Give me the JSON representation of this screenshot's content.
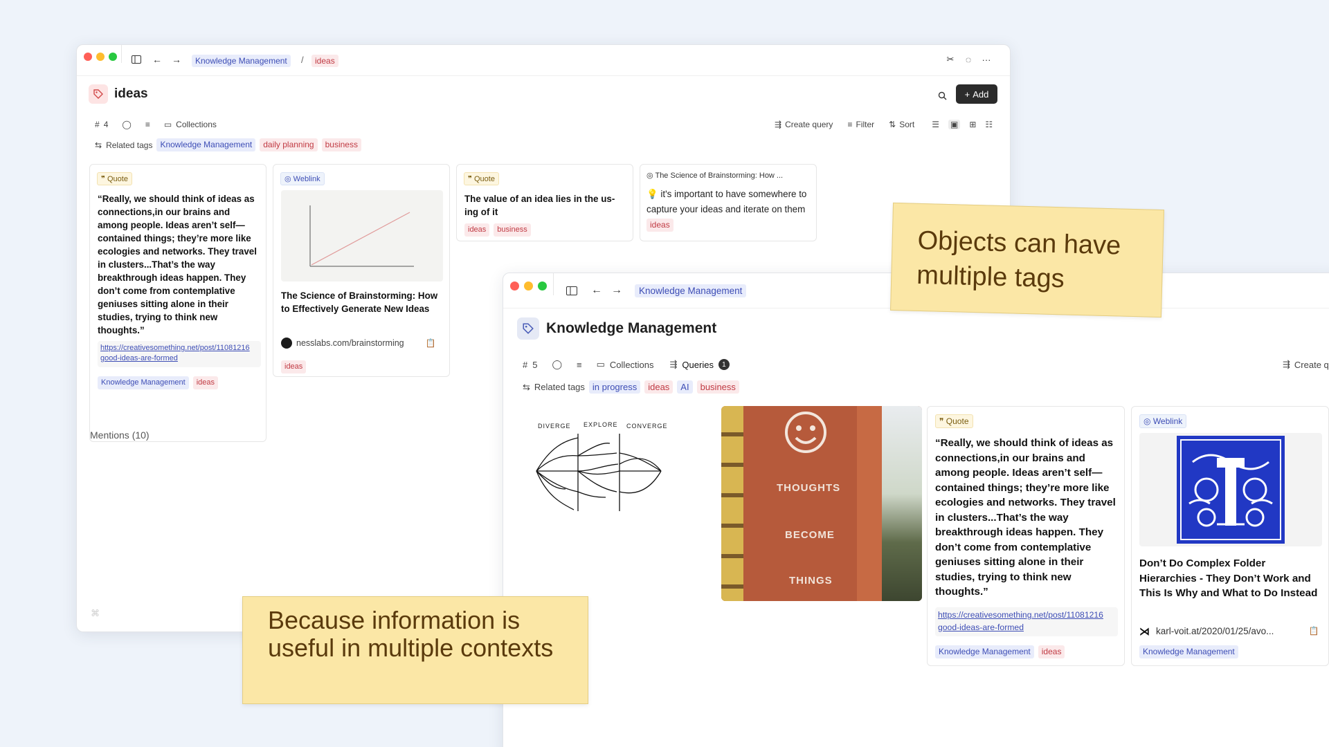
{
  "colors": {
    "accent": "#3d4db5",
    "tag_red": "#c03a43",
    "note_bg": "#fbe7a6"
  },
  "win1": {
    "breadcrumb": [
      "Knowledge Management",
      "ideas"
    ],
    "breadcrumb_sep": "/",
    "title": "ideas",
    "add_label": "Add",
    "count": "4",
    "collections_label": "Collections",
    "create_query_label": "Create query",
    "filter_label": "Filter",
    "sort_label": "Sort",
    "related_tags_label": "Related tags",
    "related_tags": [
      "Knowledge Management",
      "daily planning",
      "business"
    ],
    "cards": [
      {
        "badge": "Quote",
        "text": "“Really, we should think of ideas as connections,in our brains and among people. Ideas aren’t self—contained things; they’re more like ecologies and networks. They travel in clusters...That’s the way breakthrough ideas happen. They don’t come from contemplative geniuses sitting alone in their studies, trying to think new thoughts.”",
        "link": "https://creativesomething.net/post/11081216 good-ideas-are-formed",
        "tags": [
          "Knowledge Management",
          "ideas"
        ]
      },
      {
        "badge": "Weblink",
        "title": "The Science of Brainstorming: How to Effectively Generate New Ideas",
        "source": "nesslabs.com/brainstorming",
        "tags": [
          "ideas"
        ]
      },
      {
        "badge": "Quote",
        "text": "The value of an idea lies in the us-ing of it",
        "tags": [
          "ideas",
          "business"
        ]
      },
      {
        "header": "The Science of Brainstorming: How ...",
        "text": "it's important to have somewhere to capture your ideas and iterate on them",
        "tags": [
          "ideas"
        ]
      }
    ],
    "mentions": "Mentions (10)"
  },
  "win2": {
    "breadcrumb": "Knowledge Management",
    "title": "Knowledge Management",
    "count": "5",
    "collections_label": "Collections",
    "queries_label": "Queries",
    "queries_count": "1",
    "create_query_label": "Create q",
    "related_tags_label": "Related tags",
    "related_tags": [
      "in progress",
      "ideas",
      "AI",
      "business"
    ],
    "sketch_labels": [
      "DIVERGE",
      "EXPLORE",
      "CONVERGE"
    ],
    "photo_words": [
      "THOUGHTS",
      "BECOME",
      "THINGS"
    ],
    "quote_card": {
      "badge": "Quote",
      "text": "“Really, we should think of ideas as connections,in our brains and among people. Ideas aren’t self—contained things; they’re more like ecologies and networks. They travel in clusters...That’s the way breakthrough ideas happen. They don’t come from contemplative geniuses sitting alone in their studies, trying to think new thoughts.”",
      "link": "https://creativesomething.net/post/11081216 good-ideas-are-formed",
      "tags": [
        "Knowledge Management",
        "ideas"
      ]
    },
    "web_card": {
      "badge": "Weblink",
      "title": "Don’t Do Complex Folder Hierarchies - They Don’t Work and This Is Why and What to Do Instead",
      "source": "karl-voit.at/2020/01/25/avo...",
      "tags": [
        "Knowledge Management"
      ]
    }
  },
  "notes": [
    "Objects can have multiple tags",
    "Because information is useful in multiple contexts"
  ]
}
